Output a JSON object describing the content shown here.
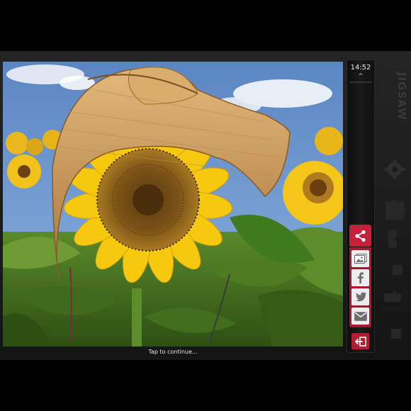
{
  "status": {
    "time": "14:52",
    "caret": "^"
  },
  "prompt": {
    "continue_text": "Tap to continue..."
  },
  "sidebar": {
    "share_icon": "share-icon",
    "actions": [
      {
        "name": "photo-gallery-icon"
      },
      {
        "name": "facebook-icon"
      },
      {
        "name": "twitter-bird-icon"
      },
      {
        "name": "email-icon"
      }
    ],
    "exit_icon": "exit-icon"
  },
  "branding": {
    "logo_text": "JIGSAW"
  },
  "colors": {
    "accent": "#c7213a",
    "accent_dark": "#a51a2e",
    "frame": "#1b1b1b",
    "sky": "#6a93c8",
    "petal": "#f6c90e"
  }
}
